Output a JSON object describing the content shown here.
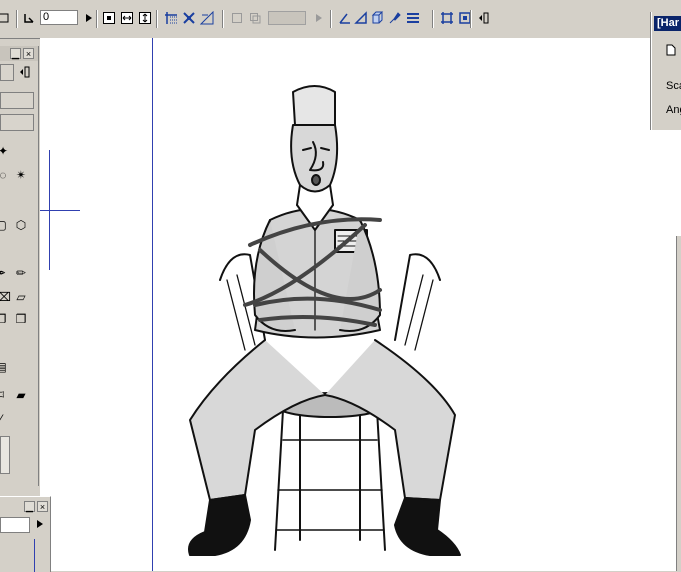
{
  "toolbar": {
    "zoom_value": "0",
    "icons": [
      "layer-icon",
      "arrow-icon",
      "dot-icon",
      "horizontal-arrows-icon",
      "vertical-arrows-icon",
      "grid-icon",
      "snap-icon",
      "measure-icon",
      "box-icon",
      "copy-icon",
      "dimension-field",
      "play-icon",
      "angle-icon",
      "triangle-icon",
      "cube-icon",
      "paint-icon",
      "align-icon",
      "frame-icon",
      "panel-icon"
    ]
  },
  "hpanel": {
    "title": "[Har",
    "label_scale": "Sca",
    "label_angle": "Ang"
  },
  "colors": {
    "chrome": "#d4d0c8",
    "canvas": "#ffffff",
    "guide": "#3040b0",
    "title_active": "#0a246a"
  }
}
